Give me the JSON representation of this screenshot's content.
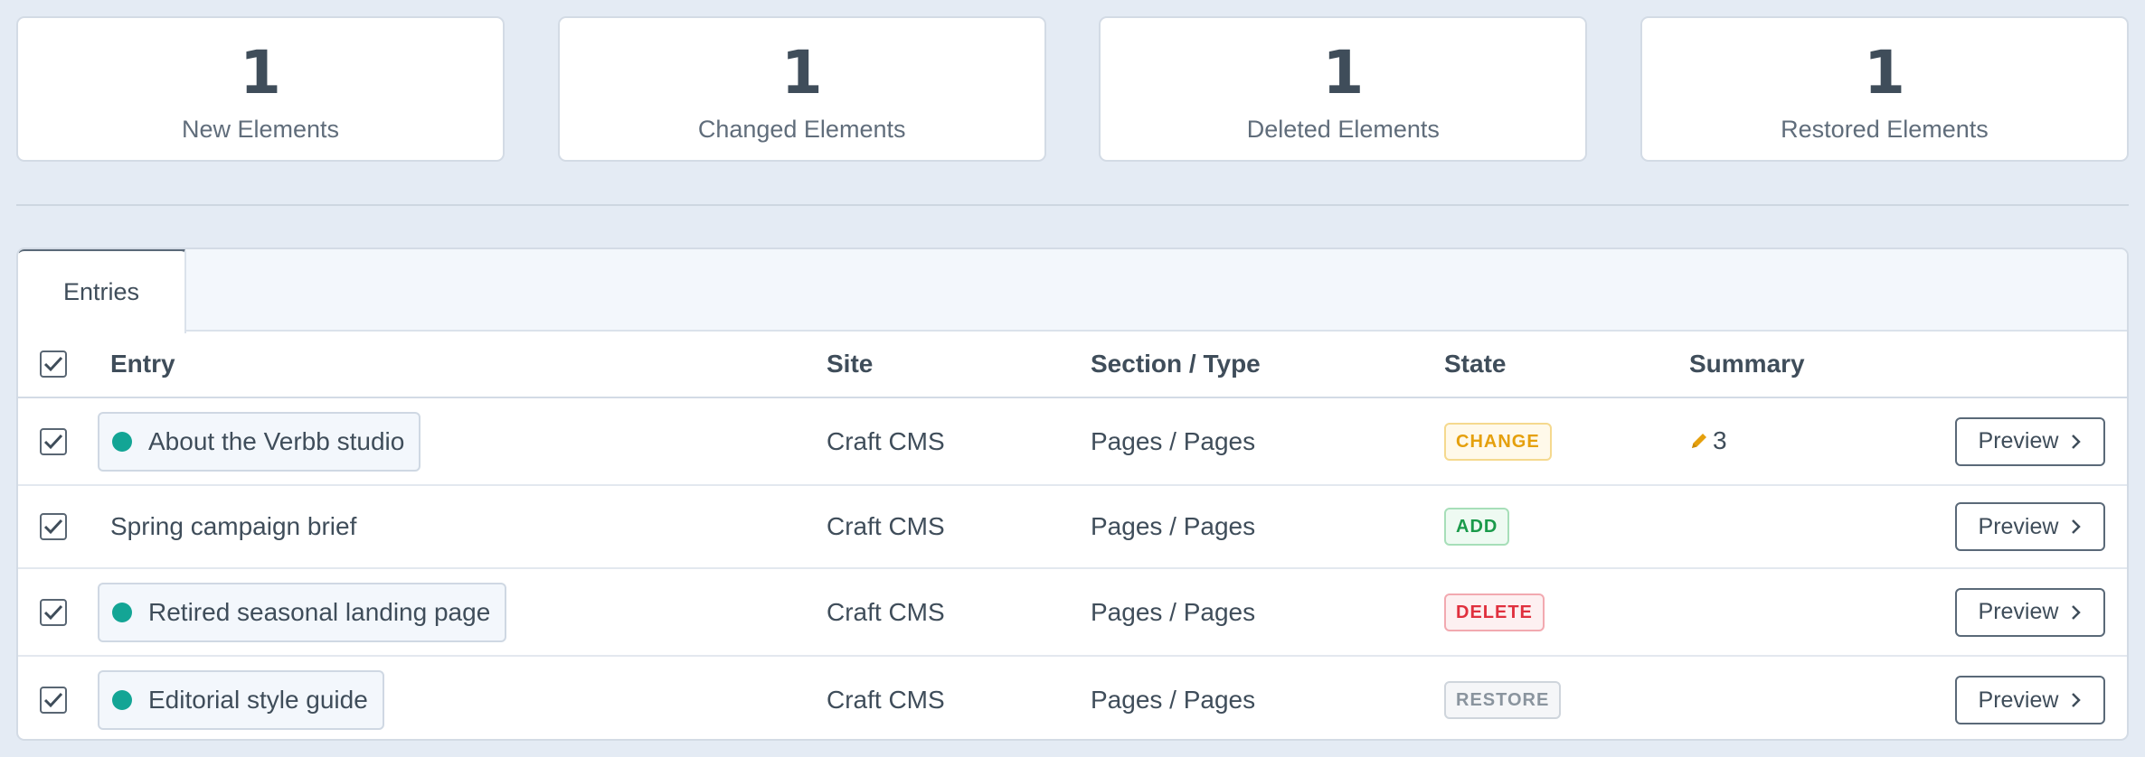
{
  "stats": [
    {
      "value": "1",
      "label": "New Elements"
    },
    {
      "value": "1",
      "label": "Changed Elements"
    },
    {
      "value": "1",
      "label": "Deleted Elements"
    },
    {
      "value": "1",
      "label": "Restored Elements"
    }
  ],
  "tabs": [
    {
      "label": "Entries",
      "active": true
    }
  ],
  "table": {
    "headers": {
      "entry": "Entry",
      "site": "Site",
      "section_type": "Section / Type",
      "state": "State",
      "summary": "Summary"
    },
    "select_all_checked": true,
    "rows": [
      {
        "checked": true,
        "entry": "About the Verbb studio",
        "has_status": true,
        "status_color": "#13a595",
        "site": "Craft CMS",
        "section_type": "Pages / Pages",
        "state": "CHANGE",
        "summary_icon": "pencil-icon",
        "summary_count": "3",
        "preview_label": "Preview"
      },
      {
        "checked": true,
        "entry": "Spring campaign brief",
        "has_status": false,
        "site": "Craft CMS",
        "section_type": "Pages / Pages",
        "state": "ADD",
        "summary_count": "",
        "preview_label": "Preview"
      },
      {
        "checked": true,
        "entry": "Retired seasonal landing page",
        "has_status": true,
        "status_color": "#13a595",
        "site": "Craft CMS",
        "section_type": "Pages / Pages",
        "state": "DELETE",
        "summary_count": "",
        "preview_label": "Preview"
      },
      {
        "checked": true,
        "entry": "Editorial style guide",
        "has_status": true,
        "status_color": "#13a595",
        "site": "Craft CMS",
        "section_type": "Pages / Pages",
        "state": "RESTORE",
        "summary_count": "",
        "preview_label": "Preview"
      }
    ]
  },
  "colors": {
    "background": "#e4ebf4",
    "change": "#e5a00d",
    "add": "#1a9a4a",
    "delete": "#e0303e",
    "restore": "#8a949e",
    "status_enabled": "#13a595"
  }
}
